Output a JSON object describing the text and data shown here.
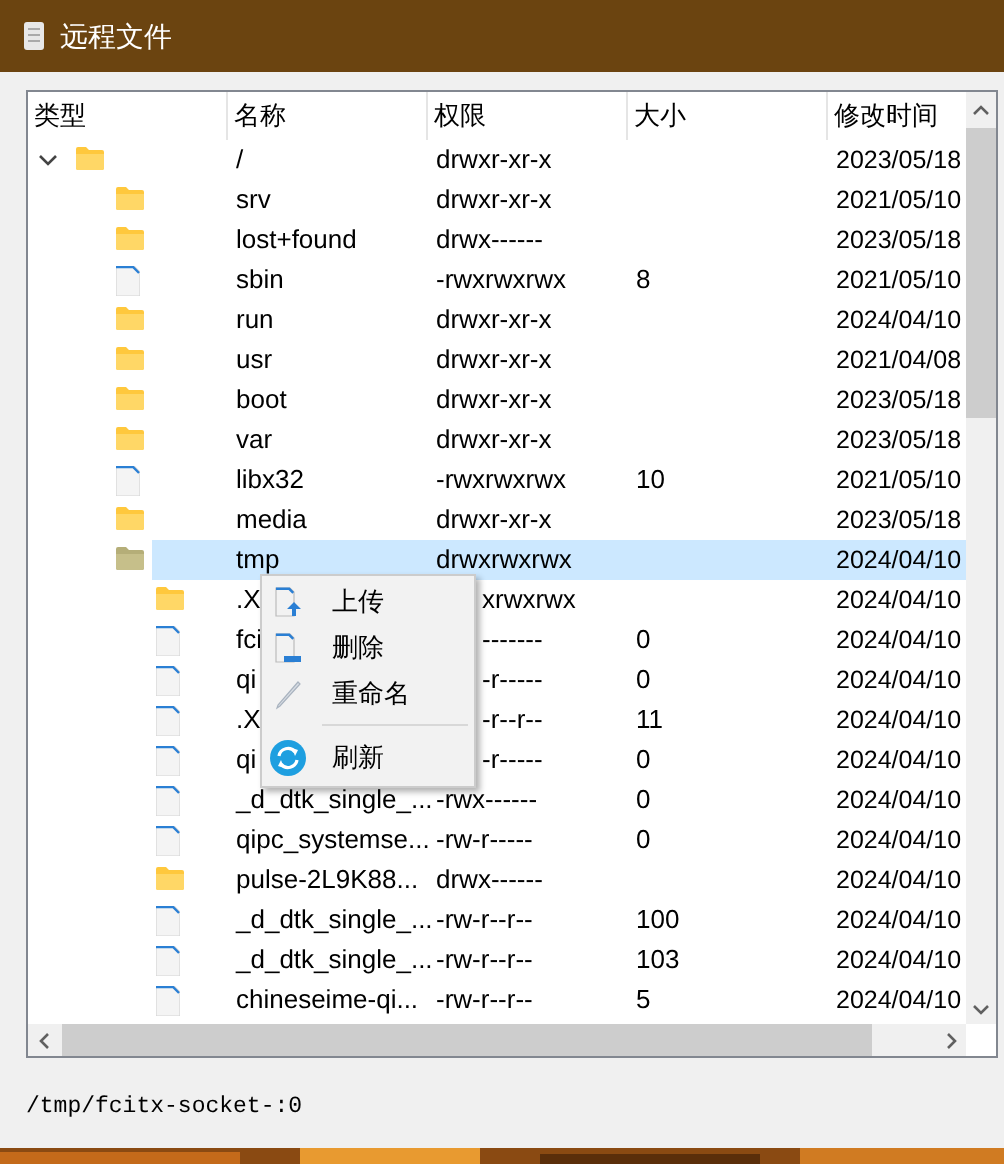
{
  "window": {
    "title": "远程文件"
  },
  "table": {
    "columns": [
      "类型",
      "名称",
      "权限",
      "大小",
      "修改时间"
    ],
    "tree": [
      {
        "kind": "folder",
        "name": "/",
        "perms": "drwxr-xr-x",
        "modified": "2023/05/18",
        "expanded": true,
        "selected": false,
        "children": [
          {
            "kind": "folder",
            "name": "srv",
            "perms": "drwxr-xr-x",
            "modified": "2021/05/10",
            "selected": false
          },
          {
            "kind": "folder",
            "name": "lost+found",
            "perms": "drwx------",
            "modified": "2023/05/18",
            "selected": false
          },
          {
            "kind": "file",
            "name": "sbin",
            "perms": "-rwxrwxrwx",
            "size": "8",
            "modified": "2021/05/10",
            "selected": false
          },
          {
            "kind": "folder",
            "name": "run",
            "perms": "drwxr-xr-x",
            "modified": "2024/04/10",
            "selected": false
          },
          {
            "kind": "folder",
            "name": "usr",
            "perms": "drwxr-xr-x",
            "modified": "2021/04/08",
            "selected": false
          },
          {
            "kind": "folder",
            "name": "boot",
            "perms": "drwxr-xr-x",
            "modified": "2023/05/18",
            "selected": false
          },
          {
            "kind": "folder",
            "name": "var",
            "perms": "drwxr-xr-x",
            "modified": "2023/05/18",
            "selected": false
          },
          {
            "kind": "file",
            "name": "libx32",
            "perms": "-rwxrwxrwx",
            "size": "10",
            "modified": "2021/05/10",
            "selected": false
          },
          {
            "kind": "folder",
            "name": "media",
            "perms": "drwxr-xr-x",
            "modified": "2023/05/18",
            "selected": false
          },
          {
            "kind": "folder",
            "name": "tmp",
            "perms": "drwxrwxrwx",
            "modified": "2024/04/10",
            "selected": true,
            "children": [
              {
                "kind": "folder",
                "name": ".X",
                "perms": "xrwxrwx",
                "modified": "2024/04/10",
                "selected": false
              },
              {
                "kind": "file",
                "name": "fci",
                "perms": "-------",
                "size": "0",
                "modified": "2024/04/10",
                "selected": false
              },
              {
                "kind": "file",
                "name": "qi",
                "perms": "-r-----",
                "size": "0",
                "modified": "2024/04/10",
                "selected": false
              },
              {
                "kind": "file",
                "name": ".X",
                "perms": "-r--r--",
                "size": "11",
                "modified": "2024/04/10",
                "selected": false
              },
              {
                "kind": "file",
                "name": "qi",
                "perms": "-r-----",
                "size": "0",
                "modified": "2024/04/10",
                "selected": false
              },
              {
                "kind": "file",
                "name": "_d_dtk_single_...",
                "perms": "-rwx------",
                "size": "0",
                "modified": "2024/04/10",
                "selected": false
              },
              {
                "kind": "file",
                "name": "qipc_systemse...",
                "perms": "-rw-r-----",
                "size": "0",
                "modified": "2024/04/10",
                "selected": false
              },
              {
                "kind": "folder",
                "name": "pulse-2L9K88...",
                "perms": "drwx------",
                "modified": "2024/04/10",
                "selected": false
              },
              {
                "kind": "file",
                "name": "_d_dtk_single_...",
                "perms": "-rw-r--r--",
                "size": "100",
                "modified": "2024/04/10",
                "selected": false
              },
              {
                "kind": "file",
                "name": "_d_dtk_single_...",
                "perms": "-rw-r--r--",
                "size": "103",
                "modified": "2024/04/10",
                "selected": false
              },
              {
                "kind": "file",
                "name": "chineseime-qi...",
                "perms": "-rw-r--r--",
                "size": "5",
                "modified": "2024/04/10",
                "selected": false
              }
            ]
          }
        ]
      }
    ]
  },
  "context_menu": {
    "items": [
      {
        "kind": "upload",
        "label": "上传"
      },
      {
        "kind": "delete",
        "label": "删除"
      },
      {
        "kind": "rename",
        "label": "重命名"
      },
      {
        "kind": "separator"
      },
      {
        "kind": "refresh",
        "label": "刷新"
      }
    ]
  },
  "status_bar": {
    "path": "/tmp/fcitx-socket-:0"
  }
}
